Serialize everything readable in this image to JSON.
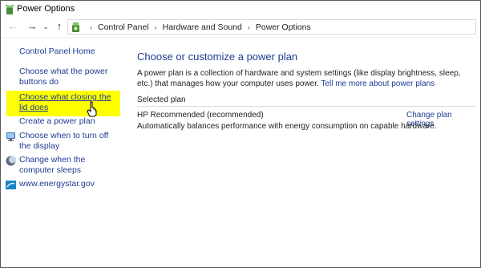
{
  "window": {
    "title": "Power Options"
  },
  "nav": {
    "back": "←",
    "forward": "→",
    "recent": "⌄",
    "up": "↑",
    "breadcrumb": [
      "Control Panel",
      "Hardware and Sound",
      "Power Options"
    ],
    "separator": "›"
  },
  "sidebar": {
    "home": "Control Panel Home",
    "items": [
      {
        "label": "Choose what the power buttons do"
      },
      {
        "label": "Choose what closing the lid does",
        "highlight_color": "#ffff00"
      },
      {
        "label": "Create a power plan"
      },
      {
        "label": "Choose when to turn off the display",
        "icon": "monitor-icon"
      },
      {
        "label": "Change when the computer sleeps",
        "icon": "moon-icon"
      },
      {
        "label": "www.energystar.gov",
        "icon": "energystar-icon"
      }
    ]
  },
  "main": {
    "title": "Choose or customize a power plan",
    "description": "A power plan is a collection of hardware and system settings (like display brightness, sleep, etc.) that manages how your computer uses power.",
    "learn_more": "Tell me more about power plans",
    "selected_plan_label": "Selected plan",
    "plan": {
      "name": "HP Recommended (recommended)",
      "change_link": "Change plan settings",
      "description": "Automatically balances performance with energy consumption on capable hardware."
    }
  },
  "colors": {
    "link": "#1e3b92",
    "highlight": "#ffff00"
  }
}
